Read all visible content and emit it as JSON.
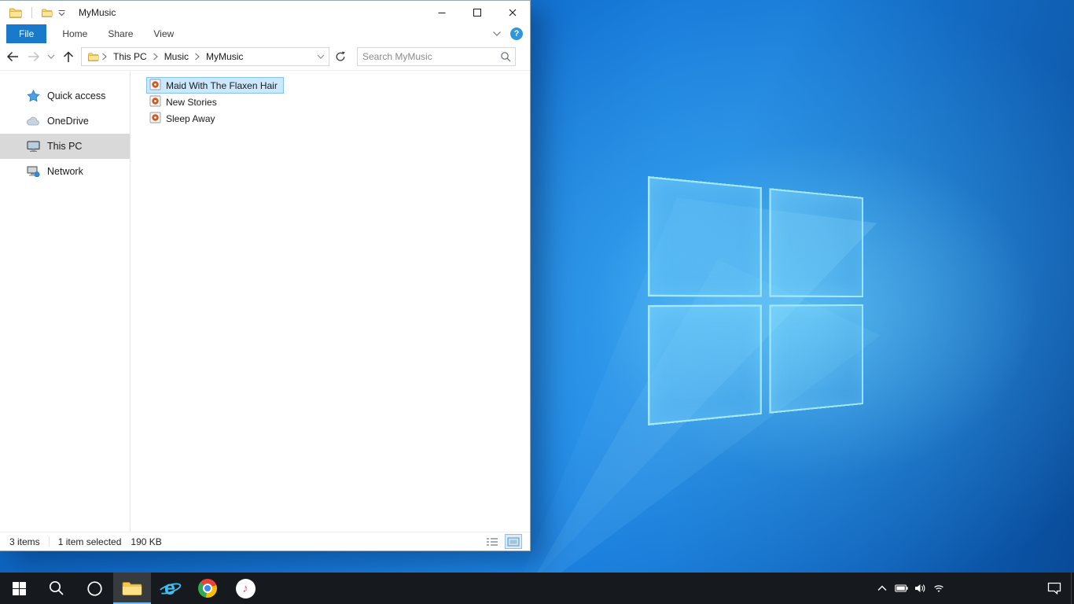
{
  "explorer": {
    "title": "MyMusic",
    "tabs": [
      {
        "label": "File",
        "active": true
      },
      {
        "label": "Home",
        "active": false
      },
      {
        "label": "Share",
        "active": false
      },
      {
        "label": "View",
        "active": false
      }
    ],
    "help_glyph": "?",
    "address": {
      "crumbs": [
        "This PC",
        "Music",
        "MyMusic"
      ],
      "search_placeholder": "Search MyMusic"
    },
    "sidebar": {
      "items": [
        {
          "label": "Quick access",
          "icon": "star-icon",
          "selected": false
        },
        {
          "label": "OneDrive",
          "icon": "cloud-icon",
          "selected": false
        },
        {
          "label": "This PC",
          "icon": "monitor-icon",
          "selected": true
        },
        {
          "label": "Network",
          "icon": "network-icon",
          "selected": false
        }
      ]
    },
    "files": [
      {
        "name": "Maid With The Flaxen Hair",
        "selected": true
      },
      {
        "name": "New Stories",
        "selected": false
      },
      {
        "name": "Sleep Away",
        "selected": false
      }
    ],
    "status": {
      "count": "3 items",
      "selection": "1 item selected",
      "size": "190 KB"
    }
  },
  "taskbar": {
    "ie_glyph": "e",
    "itunes_glyph": "♪",
    "buttons": [
      "start",
      "search",
      "cortana",
      "file-explorer",
      "internet-explorer",
      "chrome",
      "itunes"
    ],
    "tray": [
      "hidden-icons",
      "battery",
      "volume",
      "wifi",
      "action-center"
    ]
  },
  "colors": {
    "file_tab_bg": "#1979ca",
    "selection_bg": "#cce8ff",
    "selection_border": "#84c3f2",
    "sidebar_selected_bg": "#d9d9d9",
    "taskbar_bg": "#16191d",
    "desktop_base": "#0f6ac7"
  }
}
